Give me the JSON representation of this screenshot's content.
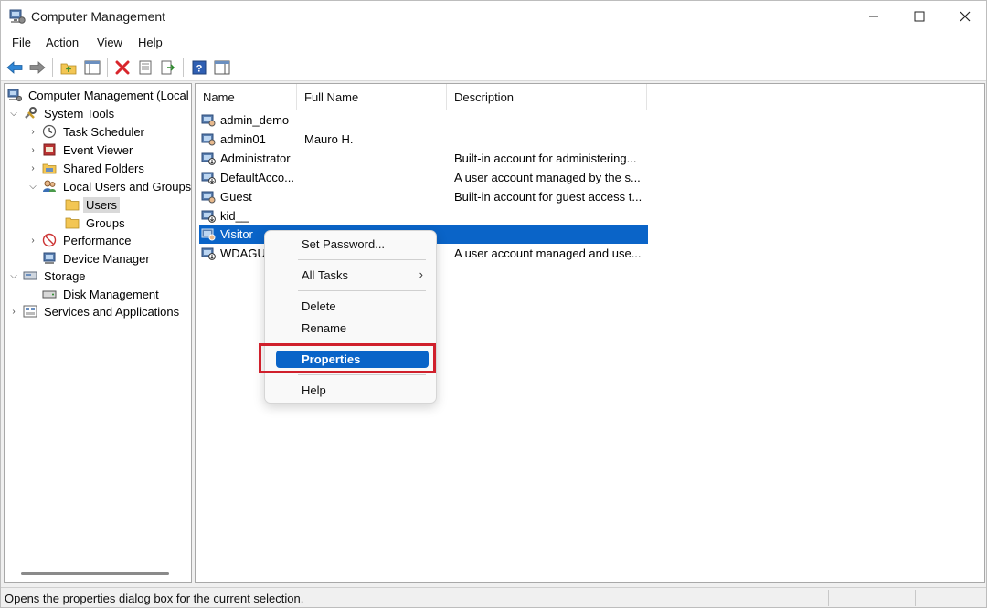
{
  "window": {
    "title": "Computer Management"
  },
  "menu": [
    "File",
    "Action",
    "View",
    "Help"
  ],
  "tree": {
    "root": "Computer Management (Local",
    "system_tools": "System Tools",
    "task_scheduler": "Task Scheduler",
    "event_viewer": "Event Viewer",
    "shared_folders": "Shared Folders",
    "local_users_groups": "Local Users and Groups",
    "users": "Users",
    "groups": "Groups",
    "performance": "Performance",
    "device_manager": "Device Manager",
    "storage": "Storage",
    "disk_management": "Disk Management",
    "services_apps": "Services and Applications"
  },
  "columns": {
    "name": "Name",
    "full_name": "Full Name",
    "description": "Description"
  },
  "users": [
    {
      "name": "admin_demo",
      "full_name": "",
      "description": ""
    },
    {
      "name": "admin01",
      "full_name": "Mauro H.",
      "description": ""
    },
    {
      "name": "Administrator",
      "full_name": "",
      "description": "Built-in account for administering..."
    },
    {
      "name": "DefaultAcco...",
      "full_name": "",
      "description": "A user account managed by the s..."
    },
    {
      "name": "Guest",
      "full_name": "",
      "description": "Built-in account for guest access t..."
    },
    {
      "name": "kid__",
      "full_name": "",
      "description": ""
    },
    {
      "name": "Visitor",
      "full_name": "",
      "description": ""
    },
    {
      "name": "WDAGU:",
      "full_name": "",
      "description": "A user account managed and use..."
    }
  ],
  "context_menu": {
    "set_password": "Set Password...",
    "all_tasks": "All Tasks",
    "all_tasks_arrow": "›",
    "delete": "Delete",
    "rename": "Rename",
    "properties": "Properties",
    "help": "Help"
  },
  "status": {
    "text": "Opens the properties dialog box for the current selection."
  },
  "colors": {
    "selection": "#0a64c8",
    "annotation": "#d0202c"
  }
}
